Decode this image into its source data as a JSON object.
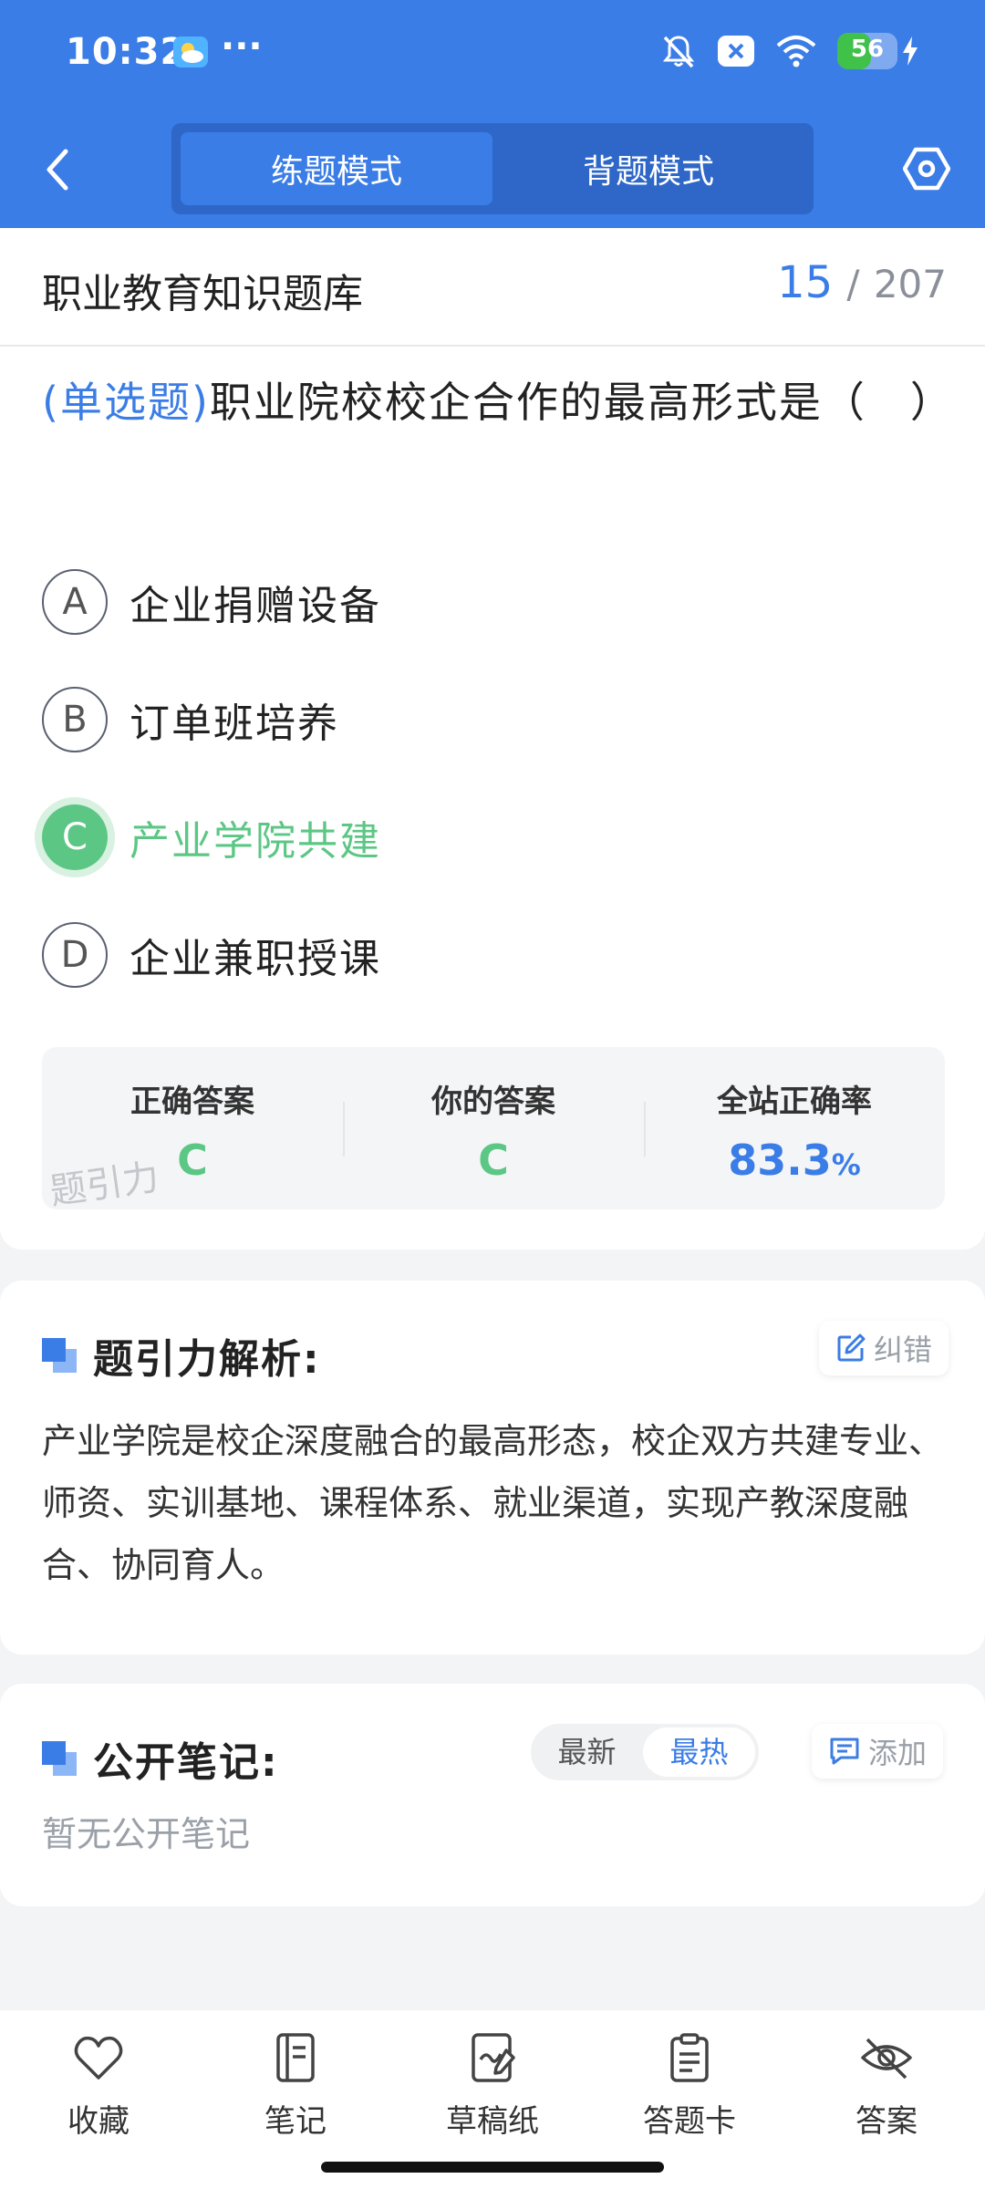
{
  "status_bar": {
    "time": "10:32",
    "more": "···",
    "battery": "56",
    "battery_level": 0.56
  },
  "header": {
    "tabs": [
      {
        "label": "练题模式",
        "active": true
      },
      {
        "label": "背题模式",
        "active": false
      }
    ]
  },
  "question_bank": {
    "title": "职业教育知识题库",
    "current": "15",
    "separator": "/",
    "total": "207"
  },
  "question": {
    "type": "(单选题)",
    "text": "职业院校校企合作的最高形式是（　）"
  },
  "options": [
    {
      "letter": "A",
      "text": "企业捐赠设备"
    },
    {
      "letter": "B",
      "text": "订单班培养"
    },
    {
      "letter": "C",
      "text": "产业学院共建"
    },
    {
      "letter": "D",
      "text": "企业兼职授课"
    }
  ],
  "result": {
    "correct_label": "正确答案",
    "correct_value": "C",
    "yours_label": "你的答案",
    "yours_value": "C",
    "rate_label": "全站正确率",
    "rate_value": "83.3",
    "rate_unit": "%",
    "watermark": "题引力"
  },
  "analysis": {
    "title": "题引力解析:",
    "report_label": "纠错",
    "text": "产业学院是校企深度融合的最高形态，校企双方共建专业、师资、实训基地、课程体系、就业渠道，实现产教深度融合、协同育人。"
  },
  "notes": {
    "title": "公开笔记:",
    "sort_latest": "最新",
    "sort_hot": "最热",
    "add_label": "添加",
    "empty": "暂无公开笔记"
  },
  "bottom_nav": [
    {
      "label": "收藏",
      "icon": "heart-icon"
    },
    {
      "label": "笔记",
      "icon": "notebook-icon"
    },
    {
      "label": "草稿纸",
      "icon": "scratchpad-icon"
    },
    {
      "label": "答题卡",
      "icon": "answer-sheet-icon"
    },
    {
      "label": "答案",
      "icon": "eye-off-icon"
    }
  ],
  "colors": {
    "primary": "#3b7de6",
    "correct": "#5cc784"
  }
}
